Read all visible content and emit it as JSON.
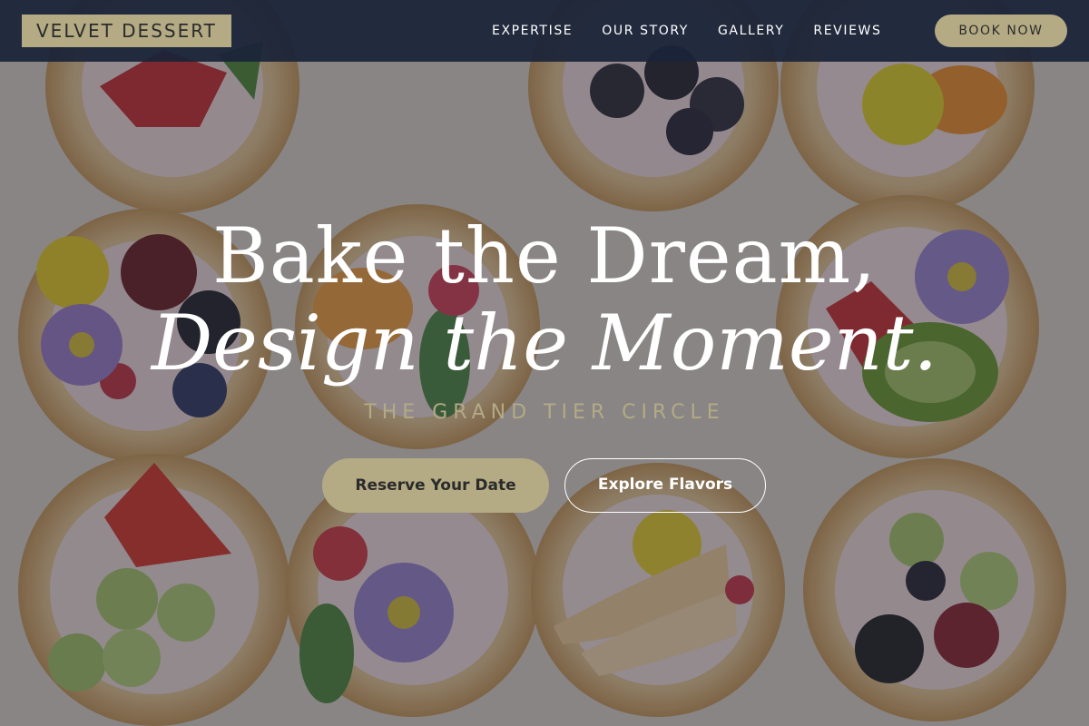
{
  "brand": {
    "logo_text": "VELVET DESSERT"
  },
  "nav": {
    "links": [
      {
        "label": "EXPERTISE"
      },
      {
        "label": "OUR STORY"
      },
      {
        "label": "GALLERY"
      },
      {
        "label": "REVIEWS"
      }
    ],
    "book_label": "BOOK NOW"
  },
  "hero": {
    "headline_line1": "Bake the Dream,",
    "headline_line2": "Design the Moment.",
    "tagline": "THE GRAND TIER CIRCLE",
    "primary_cta": "Reserve Your Date",
    "secondary_cta": "Explore Flavors"
  },
  "colors": {
    "accent": "#b4ab85",
    "navbar": "#1a2438",
    "text_light": "#ffffff"
  }
}
